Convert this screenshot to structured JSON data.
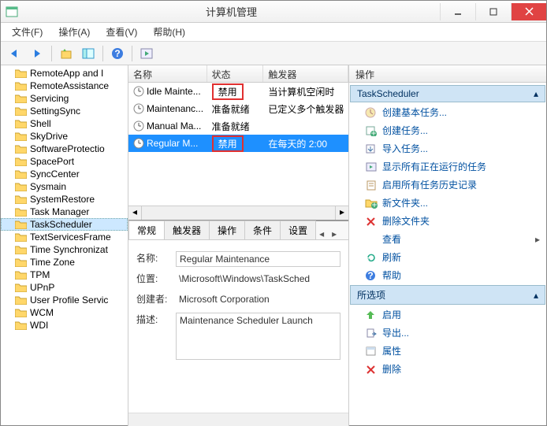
{
  "window": {
    "title": "计算机管理"
  },
  "menu": {
    "file": "文件(F)",
    "action": "操作(A)",
    "view": "查看(V)",
    "help": "帮助(H)"
  },
  "tree": {
    "items": [
      "RemoteApp and I",
      "RemoteAssistance",
      "Servicing",
      "SettingSync",
      "Shell",
      "SkyDrive",
      "SoftwareProtectio",
      "SpacePort",
      "SyncCenter",
      "Sysmain",
      "SystemRestore",
      "Task Manager",
      "TaskScheduler",
      "TextServicesFrame",
      "Time Synchronizat",
      "Time Zone",
      "TPM",
      "UPnP",
      "User Profile Servic",
      "WCM",
      "WDI"
    ],
    "selected_index": 12
  },
  "tasklist": {
    "headers": {
      "name": "名称",
      "status": "状态",
      "trigger": "触发器"
    },
    "rows": [
      {
        "name": "Idle Mainte...",
        "status": "禁用",
        "trigger": "当计算机空闲时",
        "highlight_status": true
      },
      {
        "name": "Maintenanc...",
        "status": "准备就绪",
        "trigger": "已定义多个触发器"
      },
      {
        "name": "Manual Ma...",
        "status": "准备就绪",
        "trigger": ""
      },
      {
        "name": "Regular M...",
        "status": "禁用",
        "trigger": "在每天的 2:00",
        "highlight_status": true,
        "selected": true
      }
    ]
  },
  "detail": {
    "tabs": [
      "常规",
      "触发器",
      "操作",
      "条件",
      "设置"
    ],
    "active_tab": 0,
    "name_label": "名称:",
    "name_value": "Regular Maintenance",
    "location_label": "位置:",
    "location_value": "\\Microsoft\\Windows\\TaskSched",
    "author_label": "创建者:",
    "author_value": "Microsoft Corporation",
    "desc_label": "描述:",
    "desc_value": "Maintenance Scheduler Launch"
  },
  "actions": {
    "title": "操作",
    "section1": "TaskScheduler",
    "section1_items": [
      "创建基本任务...",
      "创建任务...",
      "导入任务...",
      "显示所有正在运行的任务",
      "启用所有任务历史记录",
      "新文件夹...",
      "删除文件夹",
      "查看",
      "刷新",
      "帮助"
    ],
    "section2": "所选项",
    "section2_items": [
      "启用",
      "导出...",
      "属性",
      "删除"
    ]
  }
}
